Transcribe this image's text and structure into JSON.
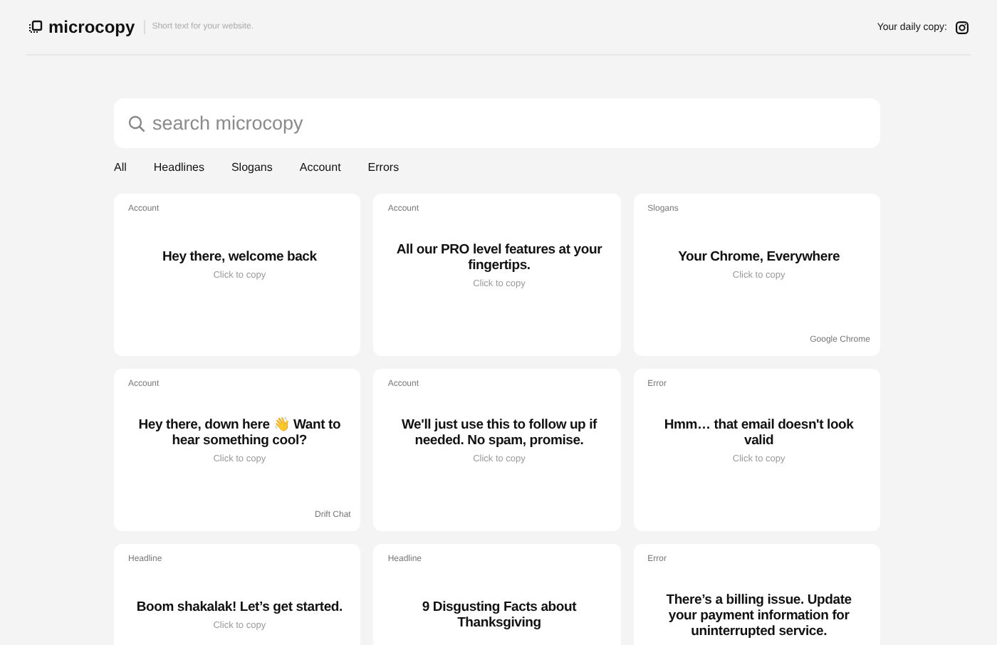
{
  "header": {
    "logo": "microcopy",
    "tagline": "Short text for your website.",
    "daily_copy_label": "Your daily copy:"
  },
  "search": {
    "placeholder": "search microcopy"
  },
  "filters": [
    {
      "label": "All"
    },
    {
      "label": "Headlines"
    },
    {
      "label": "Slogans"
    },
    {
      "label": "Account"
    },
    {
      "label": "Errors"
    }
  ],
  "cards": [
    {
      "category": "Account",
      "text": "Hey there, welcome back",
      "hint": "Click to copy"
    },
    {
      "category": "Account",
      "text": "All our PRO level features at your fingertips.",
      "hint": "Click to copy"
    },
    {
      "category": "Slogans",
      "text": "Your Chrome, Everywhere",
      "hint": "Click to copy",
      "source": "Google Chrome"
    },
    {
      "category": "Account",
      "text": "Hey there, down here 👋 Want to hear something cool?",
      "hint": "Click to copy",
      "source": "Drift Chat"
    },
    {
      "category": "Account",
      "text": "We'll just use this to follow up if needed. No spam, promise.",
      "hint": "Click to copy"
    },
    {
      "category": "Error",
      "text": "Hmm… that email doesn't look valid",
      "hint": "Click to copy"
    },
    {
      "category": "Headline",
      "text": "Boom shakalak! Let’s get started.",
      "hint": "Click to copy"
    },
    {
      "category": "Headline",
      "text": "9 Disgusting Facts about Thanksgiving"
    },
    {
      "category": "Error",
      "text": "There’s a billing issue. Update your payment information for uninterrupted service."
    }
  ]
}
